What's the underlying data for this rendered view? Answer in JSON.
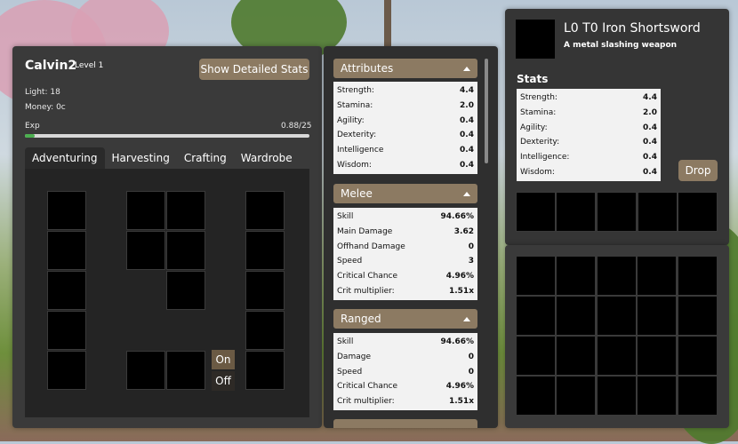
{
  "character": {
    "name": "Calvin2",
    "level": "Level 1",
    "light": "Light: 18",
    "money": "Money: 0c",
    "exp_label": "Exp",
    "exp_value": "0.88/25",
    "exp_progress": 0.035,
    "detailed_stats_button": "Show Detailed Stats"
  },
  "tabs": [
    "Adventuring",
    "Harvesting",
    "Crafting",
    "Wardrobe"
  ],
  "toggles": {
    "on": "On",
    "off": "Off"
  },
  "stats": {
    "attributes": {
      "title": "Attributes",
      "rows": [
        {
          "label": "Strength:",
          "value": "4.4"
        },
        {
          "label": "Stamina:",
          "value": "2.0"
        },
        {
          "label": "Agility:",
          "value": "0.4"
        },
        {
          "label": "Dexterity:",
          "value": "0.4"
        },
        {
          "label": "Intelligence",
          "value": "0.4"
        },
        {
          "label": "Wisdom:",
          "value": "0.4"
        }
      ]
    },
    "melee": {
      "title": "Melee",
      "rows": [
        {
          "label": "Skill",
          "value": "94.66%"
        },
        {
          "label": "Main Damage",
          "value": "3.62"
        },
        {
          "label": "Offhand Damage",
          "value": "0"
        },
        {
          "label": "Speed",
          "value": "3"
        },
        {
          "label": "Critical Chance",
          "value": "4.96%"
        },
        {
          "label": "Crit multiplier:",
          "value": "1.51x"
        }
      ]
    },
    "ranged": {
      "title": "Ranged",
      "rows": [
        {
          "label": "Skill",
          "value": "94.66%"
        },
        {
          "label": "Damage",
          "value": "0"
        },
        {
          "label": "Speed",
          "value": "0"
        },
        {
          "label": "Critical Chance",
          "value": "4.96%"
        },
        {
          "label": "Crit multiplier:",
          "value": "1.51x"
        }
      ]
    }
  },
  "item": {
    "title": "L0 T0 Iron Shortsword",
    "description": "A metal slashing weapon",
    "stats_label": "Stats",
    "rows": [
      {
        "label": "Strength:",
        "value": "4.4"
      },
      {
        "label": "Stamina:",
        "value": "2.0"
      },
      {
        "label": "Agility:",
        "value": "0.4"
      },
      {
        "label": "Dexterity:",
        "value": "0.4"
      },
      {
        "label": "Intelligence:",
        "value": "0.4"
      },
      {
        "label": "Wisdom:",
        "value": "0.4"
      }
    ],
    "drop_button": "Drop"
  },
  "colors": {
    "accent": "#8c7a62",
    "exp_fill": "#4caf50",
    "panel": "#333333"
  }
}
